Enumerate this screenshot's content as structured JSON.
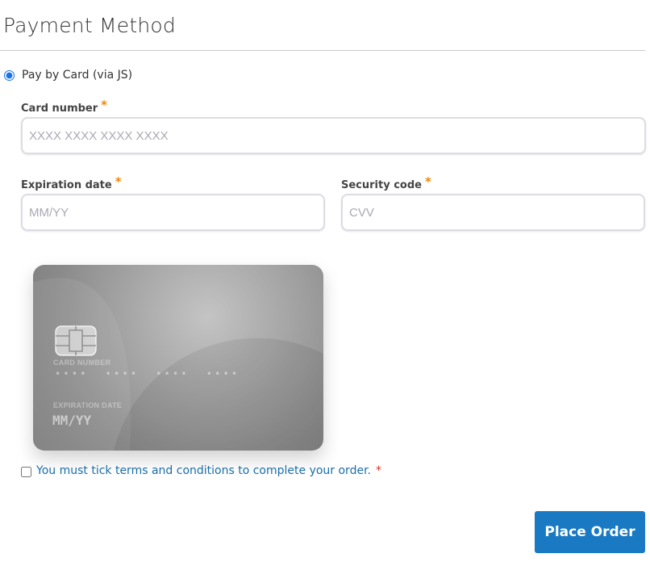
{
  "section": {
    "title": "Payment Method"
  },
  "method": {
    "label": "Pay by Card (via JS)",
    "selected": true
  },
  "fields": {
    "card_number": {
      "label": "Card number",
      "required_mark": "*",
      "placeholder": "XXXX XXXX XXXX XXXX",
      "value": ""
    },
    "expiration": {
      "label": "Expiration date",
      "required_mark": "*",
      "placeholder": "MM/YY",
      "value": ""
    },
    "security": {
      "label": "Security code",
      "required_mark": "*",
      "placeholder": "CVV",
      "value": ""
    }
  },
  "card_preview": {
    "number_label": "CARD NUMBER",
    "number_value": "••••  ••••  ••••  ••••",
    "expiration_label": "EXPIRATION DATE",
    "expiration_value": "MM/YY"
  },
  "terms": {
    "text": "You must tick terms and conditions to complete your order.",
    "required_mark": "*",
    "checked": false
  },
  "actions": {
    "place_order_label": "Place Order"
  },
  "colors": {
    "accent": "#1979c3",
    "link": "#1b6ea7",
    "required_label": "#e8890c",
    "required_terms": "#e02b27"
  },
  "icons": [
    "chip-icon"
  ]
}
